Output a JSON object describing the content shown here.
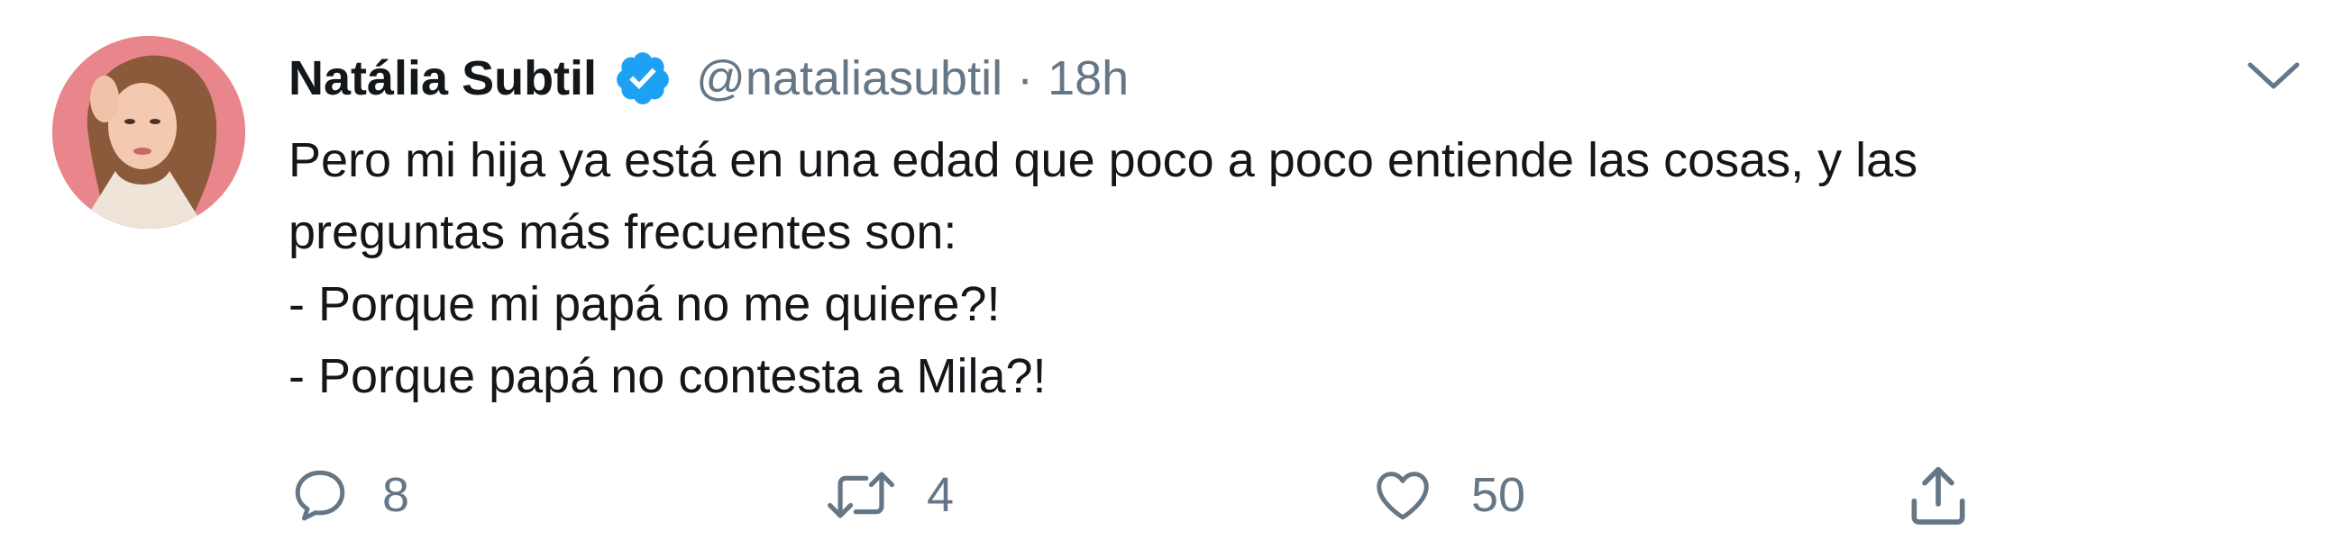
{
  "tweet": {
    "author": {
      "display_name": "Natália Subtil",
      "handle": "@nataliasubtil",
      "verified": true,
      "avatar_icon": "profile-photo"
    },
    "separator": "·",
    "time": "18h",
    "menu_icon": "chevron-down-icon",
    "text_lines": [
      "Pero mi hija ya está en una edad que poco a poco entiende las cosas, y las",
      "preguntas más frecuentes son:",
      "- Porque mi papá no me quiere?!",
      "- Porque papá no contesta a Mila?!"
    ],
    "actions": {
      "reply": {
        "icon": "reply-icon",
        "count": "8"
      },
      "retweet": {
        "icon": "retweet-icon",
        "count": "4"
      },
      "like": {
        "icon": "heart-icon",
        "count": "50"
      },
      "share": {
        "icon": "share-icon"
      }
    }
  },
  "colors": {
    "text": "#14171a",
    "secondary": "#657786",
    "verified": "#1da1f2",
    "background": "#ffffff"
  }
}
